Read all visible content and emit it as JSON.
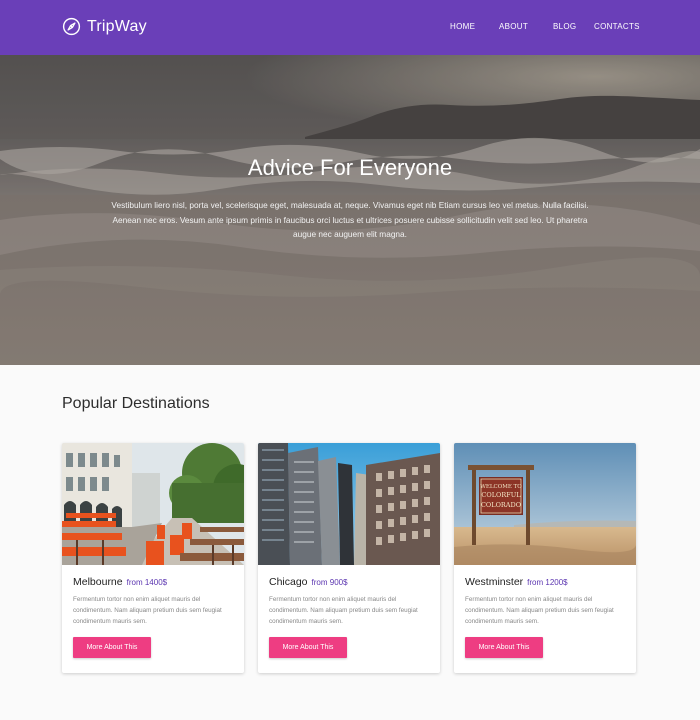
{
  "brand": {
    "name": "TripWay",
    "icon": "compass-icon"
  },
  "nav": {
    "items": [
      "HOME",
      "ABOUT",
      "BLOG",
      "CONTACTS"
    ]
  },
  "hero": {
    "title": "Advice For Everyone",
    "text": "Vestibulum liero nisl, porta vel, scelerisque eget, malesuada at, neque. Vivamus eget nib Etiam cursus leo vel metus. Nulla facilisi. Aenean nec eros. Vesum ante ipsum primis in faucibus orci luctus et ultrices posuere cubisse sollicitudin velit sed leo. Ut pharetra augue nec auguem elit magna."
  },
  "destinations": {
    "title": "Popular Destinations",
    "cards": [
      {
        "name": "Melbourne",
        "price": "from 1400$",
        "text": "Fermentum tortor non enim aliquet mauris del condimentum. Nam aliquam pretium duis sem feugiat condimentum mauris sem.",
        "button": "More About This"
      },
      {
        "name": "Chicago",
        "price": "from 900$",
        "text": "Fermentum tortor non enim aliquet mauris del condimentum. Nam aliquam pretium duis sem feugiat condimentum mauris sem.",
        "button": "More About This"
      },
      {
        "name": "Westminster",
        "price": "from 1200$",
        "text": "Fermentum tortor non enim aliquet mauris del condimentum. Nam aliquam pretium duis sem feugiat condimentum mauris sem.",
        "button": "More About This"
      }
    ]
  },
  "sign_text": [
    "WELCOME TO",
    "COLORFUL",
    "COLORADO"
  ],
  "colors": {
    "header": "#6a3fb8",
    "accent": "#ee3d82",
    "price": "#5b35b0"
  }
}
